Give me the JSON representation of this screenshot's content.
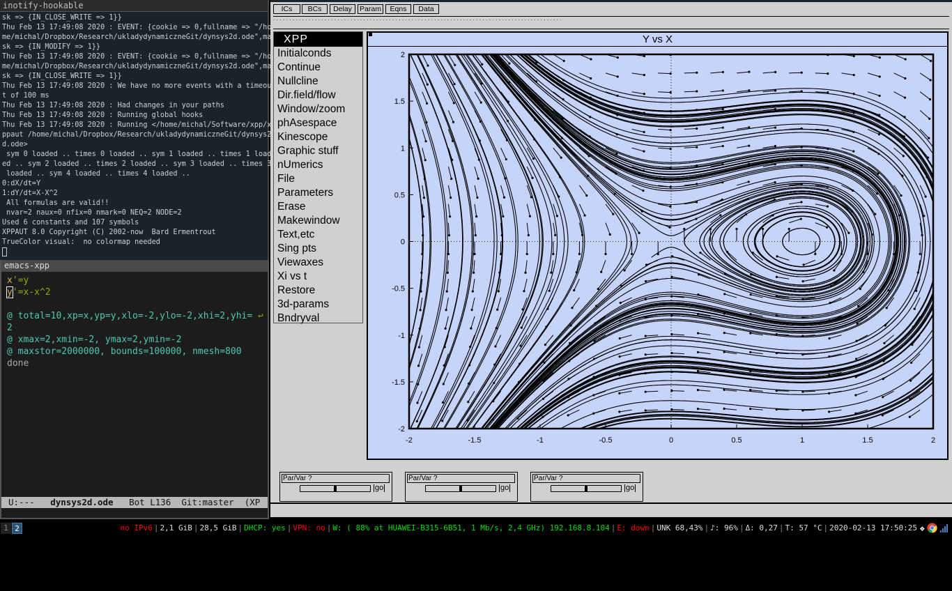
{
  "terminal": {
    "title": "inotify-hookable",
    "lines": [
      "sk => {IN_CLOSE_WRITE => 1}}",
      "Thu Feb 13 17:49:08 2020 : EVENT: {cookie => 0,fullname => \"/ho",
      "me/michal/Dropbox/Research/ukladydynamiczneGit/dynsys2d.ode\",ma",
      "sk => {IN_MODIFY => 1}}",
      "Thu Feb 13 17:49:08 2020 : EVENT: {cookie => 0,fullname => \"/ho",
      "me/michal/Dropbox/Research/ukladydynamiczneGit/dynsys2d.ode\",ma",
      "sk => {IN_CLOSE_WRITE => 1}}",
      "Thu Feb 13 17:49:08 2020 : We have no more events with a timeou",
      "t of 100 ms",
      "Thu Feb 13 17:49:08 2020 : Had changes in your paths",
      "Thu Feb 13 17:49:08 2020 : Running global hooks",
      "Thu Feb 13 17:49:08 2020 : Running </home/michal/Software/xpp/x",
      "ppaut /home/michal/Dropbox/Research/ukladydynamiczneGit/dynsys2",
      "d.ode>",
      " sym 0 loaded .. times 0 loaded .. sym 1 loaded .. times 1 load",
      "ed .. sym 2 loaded .. times 2 loaded .. sym 3 loaded .. times 3",
      " loaded .. sym 4 loaded .. times 4 loaded ..",
      "0:dX/dt=Y",
      "1:dY/dt=X-X^2",
      " All formulas are valid!!",
      " nvar=2 naux=0 nfix=0 nmark=0 NEQ=2 NODE=2",
      "Used 6 constants and 107 symbols",
      "XPPAUT 8.0 Copyright (C) 2002-now  Bard Ermentrout",
      "TrueColor visual:  no colormap needed"
    ]
  },
  "emacs": {
    "title": "emacs-xpp",
    "line1_var": "x",
    "line1_rest": "'=y",
    "line2_var": "y",
    "line2_rest": "'=x-x^2",
    "line3": "@ total=10,xp=x,yp=y,xlo=-2,ylo=-2,xhi=2,yhi=",
    "line3_wrap": "2",
    "line4": "@ xmax=2,xmin=-2, ymax=2,ymin=-2",
    "line5": "@ maxstor=2000000, bounds=100000, nmesh=800",
    "line6": "done",
    "modeline": {
      "state": "U:---",
      "file": "dynsys2d.ode",
      "pos": "Bot L136",
      "vc": "Git:master",
      "mode": "(XP"
    }
  },
  "statusbar": {
    "workspaces": [
      "1",
      "2"
    ],
    "active_workspace": "2",
    "ipv6": "no IPv6",
    "mem": "2,1 GiB",
    "disk": "28,5 GiB",
    "dhcp": "DHCP: yes",
    "vpn": "VPN: no",
    "wifi": "W: ( 88% at HUAWEI-B315-6B51, 1 Mb/s, 2,4 GHz) 192.168.8.104",
    "eth": "E: down",
    "battery": "UNK 68,43%",
    "volume": "♪: 96%",
    "load": "Δ: 0,27",
    "temp": "T: 57 °C",
    "datetime": "2020-02-13 17:50:25",
    "colors": {
      "good": "#00e000",
      "bad": "#ff0000"
    }
  },
  "xpp": {
    "toolbar": [
      "ICs",
      "BCs",
      "Delay",
      "Param",
      "Eqns",
      "Data"
    ],
    "command_line": "..........................................................................................",
    "menu_title": "XPP",
    "menu": [
      "Initialconds",
      "Continue",
      "Nullcline",
      "Dir.field/flow",
      "Window/zoom",
      "phAsespace",
      "Kinescope",
      "Graphic stuff",
      "nUmerics",
      "File",
      "Parameters",
      "Erase",
      "Makewindow",
      "Text,etc",
      "Sing pts",
      "Viewaxes",
      "Xi vs t",
      "Restore",
      "3d-params",
      "Bndryval"
    ],
    "plot": {
      "title": "Y vs X",
      "equations": {
        "dx": "y",
        "dy": "x-x^2"
      },
      "xlim": [
        -2,
        2
      ],
      "ylim": [
        -2,
        2
      ],
      "xticks": [
        "-2",
        "-1.5",
        "-1",
        "-0.5",
        "0",
        "0.5",
        "1",
        "1.5",
        "2"
      ],
      "yticks": [
        "2",
        "1.5",
        "1",
        "0.5",
        "0",
        "-0.5",
        "-1",
        "-1.5",
        "-2"
      ],
      "background": "#c6d4fa"
    },
    "sliders": [
      {
        "label": "Par/Var ?",
        "go": "go",
        "value": 0.5
      },
      {
        "label": "Par/Var ?",
        "go": "go",
        "value": 0.5
      },
      {
        "label": "Par/Var ?",
        "go": "go",
        "value": 0.5
      }
    ]
  }
}
